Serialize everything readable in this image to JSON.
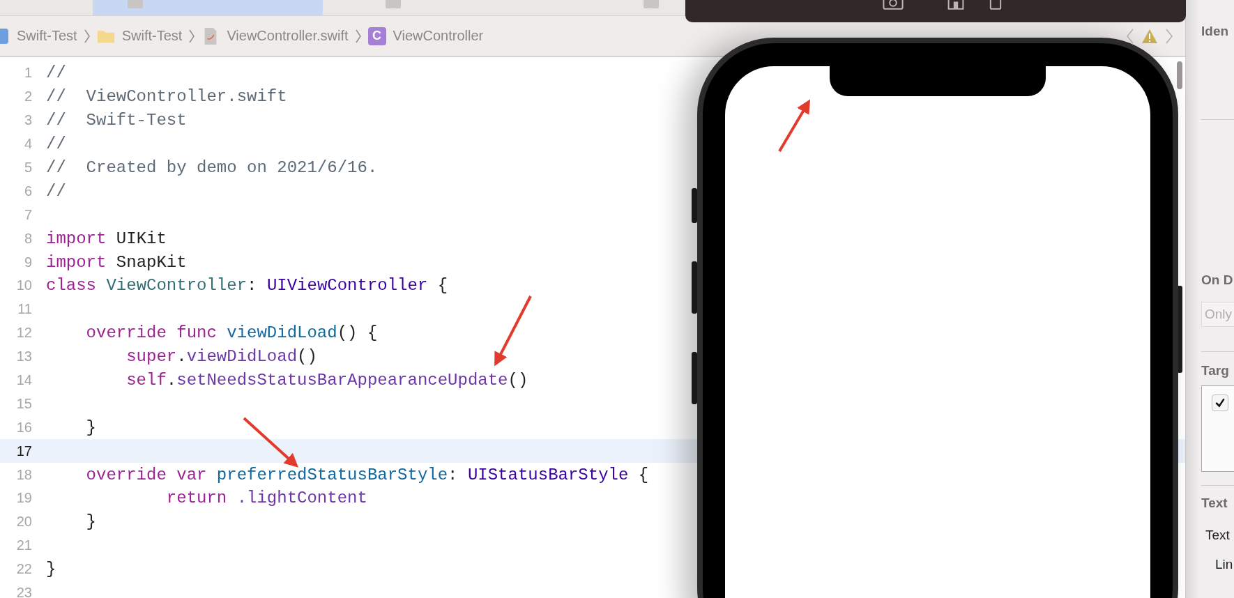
{
  "tabs": [
    {
      "selected": true
    },
    {
      "selected": false
    },
    {
      "selected": false
    }
  ],
  "breadcrumb": [
    {
      "kind": "project",
      "label": "Swift-Test"
    },
    {
      "kind": "folder",
      "label": "Swift-Test"
    },
    {
      "kind": "swift",
      "label": "ViewController.swift"
    },
    {
      "kind": "class",
      "label": "ViewController",
      "icon": "C"
    }
  ],
  "code": {
    "lines": [
      {
        "number": "1",
        "highlighted": false,
        "tokens": [
          {
            "kind": "comment",
            "text": "//"
          }
        ]
      },
      {
        "number": "2",
        "highlighted": false,
        "tokens": [
          {
            "kind": "comment",
            "text": "//  ViewController.swift"
          }
        ]
      },
      {
        "number": "3",
        "highlighted": false,
        "tokens": [
          {
            "kind": "comment",
            "text": "//  Swift-Test"
          }
        ]
      },
      {
        "number": "4",
        "highlighted": false,
        "tokens": [
          {
            "kind": "comment",
            "text": "//"
          }
        ]
      },
      {
        "number": "5",
        "highlighted": false,
        "tokens": [
          {
            "kind": "comment",
            "text": "//  Created by demo on 2021/6/16."
          }
        ]
      },
      {
        "number": "6",
        "highlighted": false,
        "tokens": [
          {
            "kind": "comment",
            "text": "//"
          }
        ]
      },
      {
        "number": "7",
        "highlighted": false
      },
      {
        "number": "8",
        "highlighted": false,
        "tokens": [
          {
            "kind": "keyword",
            "text": "import"
          },
          {
            "kind": "plain",
            "text": " UIKit"
          }
        ]
      },
      {
        "number": "9",
        "highlighted": false,
        "tokens": [
          {
            "kind": "keyword",
            "text": "import"
          },
          {
            "kind": "plain",
            "text": " SnapKit"
          }
        ]
      },
      {
        "number": "10",
        "highlighted": false,
        "tokens": [
          {
            "kind": "keyword",
            "text": "class"
          },
          {
            "kind": "project_type",
            "text": " ViewController"
          },
          {
            "kind": "plain",
            "text": ": "
          },
          {
            "kind": "system_type",
            "text": "UIViewController"
          },
          {
            "kind": "plain",
            "text": " {"
          }
        ]
      },
      {
        "number": "11",
        "highlighted": false
      },
      {
        "number": "12",
        "highlighted": false,
        "tokens": [
          {
            "kind": "keyword",
            "text": "    override func"
          },
          {
            "kind": "declaration",
            "text": " viewDidLoad"
          },
          {
            "kind": "plain",
            "text": "() {"
          }
        ]
      },
      {
        "number": "13",
        "highlighted": false,
        "tokens": [
          {
            "kind": "keyword",
            "text": "        super"
          },
          {
            "kind": "plain",
            "text": "."
          },
          {
            "kind": "member",
            "text": "viewDidLoad"
          },
          {
            "kind": "plain",
            "text": "()"
          }
        ]
      },
      {
        "number": "14",
        "highlighted": false,
        "tokens": [
          {
            "kind": "keyword",
            "text": "        self"
          },
          {
            "kind": "plain",
            "text": "."
          },
          {
            "kind": "member",
            "text": "setNeedsStatusBarAppearanceUpdate"
          },
          {
            "kind": "plain",
            "text": "()"
          }
        ]
      },
      {
        "number": "15",
        "highlighted": false
      },
      {
        "number": "16",
        "highlighted": false,
        "tokens": [
          {
            "kind": "plain",
            "text": "    }"
          }
        ]
      },
      {
        "number": "17",
        "highlighted": true
      },
      {
        "number": "18",
        "highlighted": false,
        "tokens": [
          {
            "kind": "keyword",
            "text": "    override var"
          },
          {
            "kind": "declaration",
            "text": " preferredStatusBarStyle"
          },
          {
            "kind": "plain",
            "text": ": "
          },
          {
            "kind": "system_type",
            "text": "UIStatusBarStyle"
          },
          {
            "kind": "plain",
            "text": " {"
          }
        ]
      },
      {
        "number": "19",
        "highlighted": false,
        "tokens": [
          {
            "kind": "keyword",
            "text": "            return"
          },
          {
            "kind": "member",
            "text": " .lightContent"
          }
        ]
      },
      {
        "number": "20",
        "highlighted": false,
        "tokens": [
          {
            "kind": "plain",
            "text": "    }"
          }
        ]
      },
      {
        "number": "21",
        "highlighted": false
      },
      {
        "number": "22",
        "highlighted": false,
        "tokens": [
          {
            "kind": "plain",
            "text": "}"
          }
        ]
      },
      {
        "number": "23",
        "highlighted": false
      }
    ]
  },
  "inspector": {
    "sections": [
      {
        "kind": "heading",
        "title": "Iden"
      },
      {
        "kind": "popup",
        "title": "On D",
        "placeholder": "Only"
      },
      {
        "kind": "targets",
        "title": "Targ",
        "targets": [
          {
            "checked": true
          }
        ]
      },
      {
        "kind": "rows",
        "title": "Text",
        "rows": [
          {
            "label": "Text"
          },
          {
            "label": "Lin"
          }
        ]
      }
    ]
  }
}
